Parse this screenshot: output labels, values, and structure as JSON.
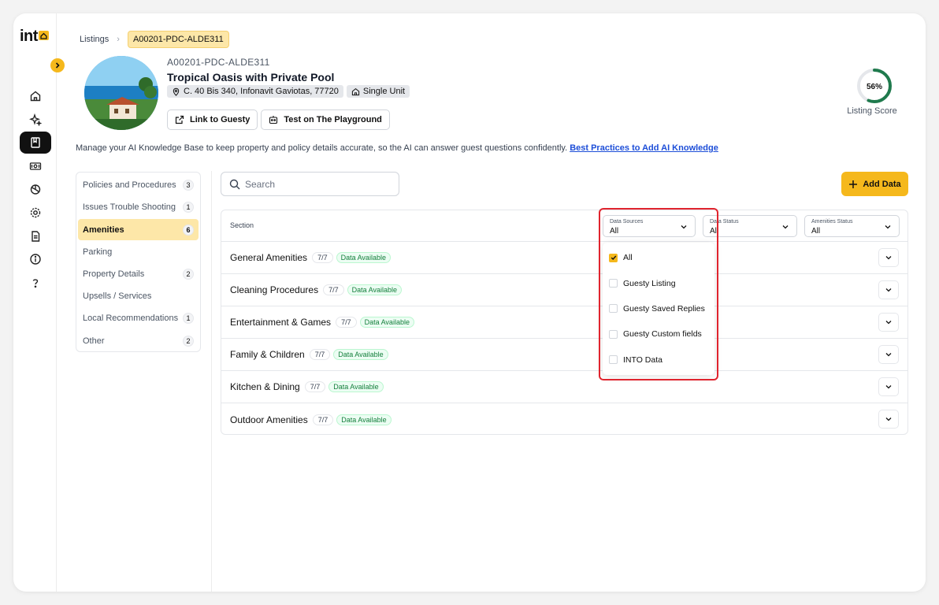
{
  "app": {
    "logo_text": "int"
  },
  "breadcrumb": {
    "root": "Listings",
    "current": "A00201-PDC-ALDE311"
  },
  "listing": {
    "id": "A00201-PDC-ALDE311",
    "title": "Tropical Oasis with Private Pool",
    "address": "C. 40 Bis 340, Infonavit Gaviotas, 77720",
    "unit_type": "Single Unit"
  },
  "actions": {
    "link": "Link to Guesty",
    "playground": "Test on The Playground"
  },
  "score": {
    "value": "56%",
    "fraction": 0.56,
    "label": "Listing Score",
    "color": "#1f7a4d"
  },
  "info": {
    "text": "Manage your AI Knowledge Base to keep property and policy details accurate, so the AI can answer guest questions confidently. ",
    "link": "Best Practices to Add AI Knowledge"
  },
  "sections": [
    {
      "label": "Policies and Procedures",
      "count": "3"
    },
    {
      "label": "Issues Trouble Shooting",
      "count": "1"
    },
    {
      "label": "Amenities",
      "count": "6"
    },
    {
      "label": "Parking",
      "count": ""
    },
    {
      "label": "Property Details",
      "count": "2"
    },
    {
      "label": "Upsells / Services",
      "count": ""
    },
    {
      "label": "Local Recommendations",
      "count": "1"
    },
    {
      "label": "Other",
      "count": "2"
    }
  ],
  "search": {
    "placeholder": "Search"
  },
  "add_button": "Add Data",
  "table": {
    "section_header": "Section",
    "filters": [
      {
        "label": "Data Sources",
        "value": "All"
      },
      {
        "label": "Data Status",
        "value": "All"
      },
      {
        "label": "Amenities Status",
        "value": "All"
      }
    ],
    "rows": [
      {
        "title": "General Amenities",
        "ratio": "7/7",
        "status": "Data Available"
      },
      {
        "title": "Cleaning Procedures",
        "ratio": "7/7",
        "status": "Data Available"
      },
      {
        "title": "Entertainment & Games",
        "ratio": "7/7",
        "status": "Data Available"
      },
      {
        "title": "Family & Children",
        "ratio": "7/7",
        "status": "Data Available"
      },
      {
        "title": "Kitchen & Dining",
        "ratio": "7/7",
        "status": "Data Available"
      },
      {
        "title": "Outdoor Amenities",
        "ratio": "7/7",
        "status": "Data Available"
      }
    ]
  },
  "dropdown": {
    "options": [
      {
        "label": "All",
        "checked": true
      },
      {
        "label": "Guesty Listing",
        "checked": false
      },
      {
        "label": "Guesty Saved Replies",
        "checked": false
      },
      {
        "label": "Guesty Custom fields",
        "checked": false
      },
      {
        "label": "INTO Data",
        "checked": false
      }
    ]
  },
  "colors": {
    "accent": "#f5b81c",
    "highlight": "#e0242e"
  }
}
